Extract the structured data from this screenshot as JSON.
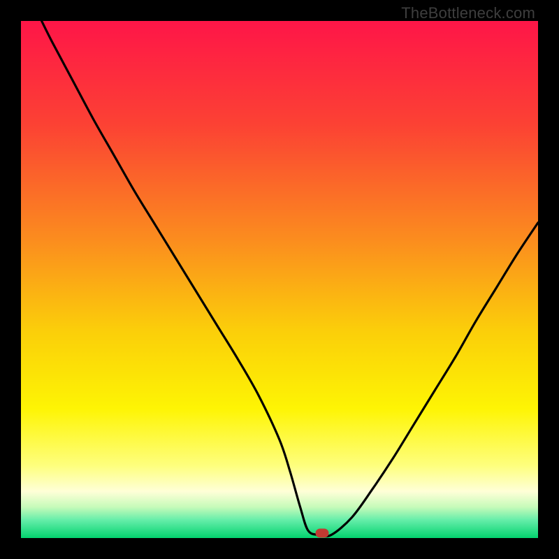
{
  "watermark": "TheBottleneck.com",
  "chart_data": {
    "type": "line",
    "title": "",
    "xlabel": "",
    "ylabel": "",
    "xlim": [
      0,
      100
    ],
    "ylim": [
      0,
      100
    ],
    "gradient_stops": [
      {
        "pos": 0.0,
        "color": "#ff1648"
      },
      {
        "pos": 0.2,
        "color": "#fc4234"
      },
      {
        "pos": 0.42,
        "color": "#fb8c1f"
      },
      {
        "pos": 0.6,
        "color": "#fbcf0a"
      },
      {
        "pos": 0.75,
        "color": "#fef504"
      },
      {
        "pos": 0.86,
        "color": "#feff7e"
      },
      {
        "pos": 0.91,
        "color": "#ffffd8"
      },
      {
        "pos": 0.94,
        "color": "#c7fbba"
      },
      {
        "pos": 0.965,
        "color": "#66eeaa"
      },
      {
        "pos": 1.0,
        "color": "#03d36f"
      }
    ],
    "series": [
      {
        "name": "bottleneck-curve",
        "x": [
          4,
          6,
          10,
          14,
          18,
          22,
          26,
          30,
          34,
          38,
          42,
          46,
          50,
          52,
          54,
          55.5,
          57.5,
          60,
          64,
          68,
          72,
          76,
          80,
          84,
          88,
          92,
          96,
          100
        ],
        "y": [
          100,
          96,
          88.5,
          81,
          74,
          67,
          60.5,
          54,
          47.5,
          41,
          34.5,
          27.5,
          19,
          13,
          6,
          1.5,
          0.6,
          0.6,
          4,
          9.5,
          15.5,
          22,
          28.5,
          35,
          42,
          48.5,
          55,
          61
        ]
      }
    ],
    "marker": {
      "x": 58.2,
      "y": 0.9,
      "color": "#c13a32"
    }
  }
}
